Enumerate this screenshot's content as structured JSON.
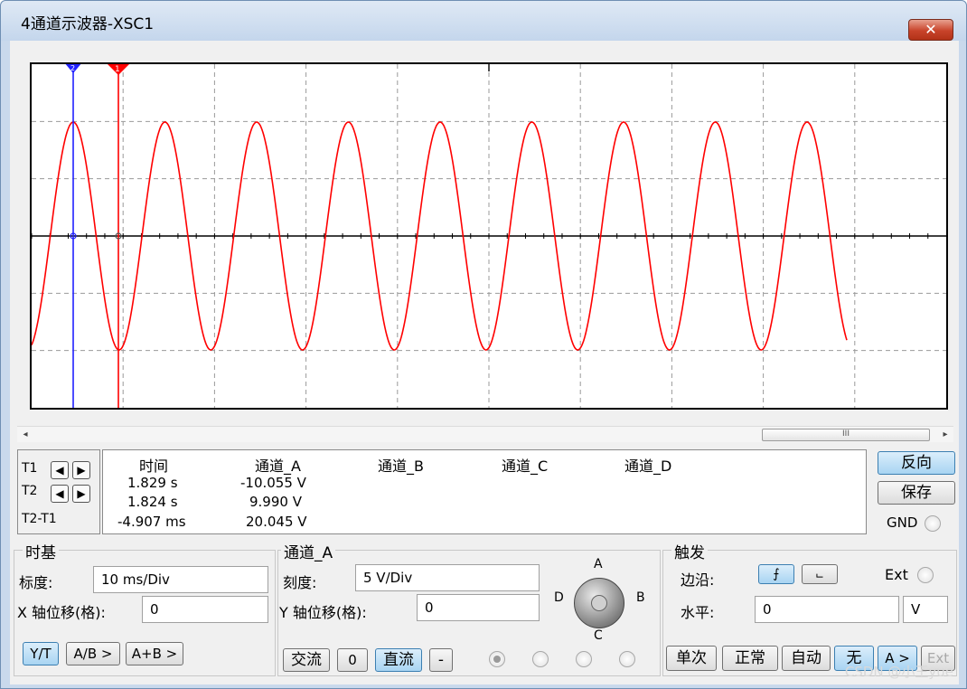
{
  "window": {
    "title": "4通道示波器-XSC1",
    "close_label": "✕"
  },
  "scroll": {
    "left_arrow": "◂",
    "right_arrow": "▸",
    "thumb_grip": "III"
  },
  "cursors": {
    "t1_label": "T1",
    "t2_label": "T2",
    "t2t1_label": "T2-T1",
    "left_arrow": "◀",
    "right_arrow": "▶",
    "t1_marker": "1",
    "t2_marker": "2"
  },
  "readout": {
    "headers": {
      "time": "时间",
      "ch_a": "通道_A",
      "ch_b": "通道_B",
      "ch_c": "通道_C",
      "ch_d": "通道_D"
    },
    "rows": [
      {
        "time": "1.829 s",
        "ch_a": "-10.055 V"
      },
      {
        "time": "1.824 s",
        "ch_a": "9.990 V"
      },
      {
        "time": "-4.907 ms",
        "ch_a": "20.045 V"
      }
    ]
  },
  "side": {
    "reverse_label": "反向",
    "save_label": "保存",
    "gnd_label": "GND"
  },
  "timebase": {
    "group_label": "时基",
    "scale_label": "标度:",
    "scale_value": "10 ms/Div",
    "xpos_label": "X 轴位移(格):",
    "xpos_value": "0",
    "yt_label": "Y/T",
    "ab_label": "A/B >",
    "apb_label": "A+B >"
  },
  "channel": {
    "group_label": "通道_A",
    "scale_label": "刻度:",
    "scale_value": "5  V/Div",
    "ypos_label": "Y 轴位移(格):",
    "ypos_value": "0",
    "ac_label": "交流",
    "zero_label": "0",
    "dc_label": "直流",
    "minus_label": "-",
    "knob": {
      "a": "A",
      "b": "B",
      "c": "C",
      "d": "D",
      "selected": "A"
    }
  },
  "trigger": {
    "group_label": "触发",
    "edge_label": "边沿:",
    "rising_icon": "rising-edge-icon",
    "falling_icon": "falling-edge-icon",
    "rising_glyph": "⨍",
    "falling_glyph": "⨽",
    "ext_label": "Ext",
    "level_label": "水平:",
    "level_value": "0",
    "level_unit": "V",
    "single_label": "单次",
    "normal_label": "正常",
    "auto_label": "自动",
    "none_label": "无",
    "a_label": "A >",
    "ext_btn_label": "Ext"
  },
  "watermark": "CSDN @小王yue",
  "colors": {
    "trace_a": "#ff0000",
    "cursor_t1": "#ff0000",
    "cursor_t2": "#2020ff",
    "grid": "#9a9a9a"
  }
}
